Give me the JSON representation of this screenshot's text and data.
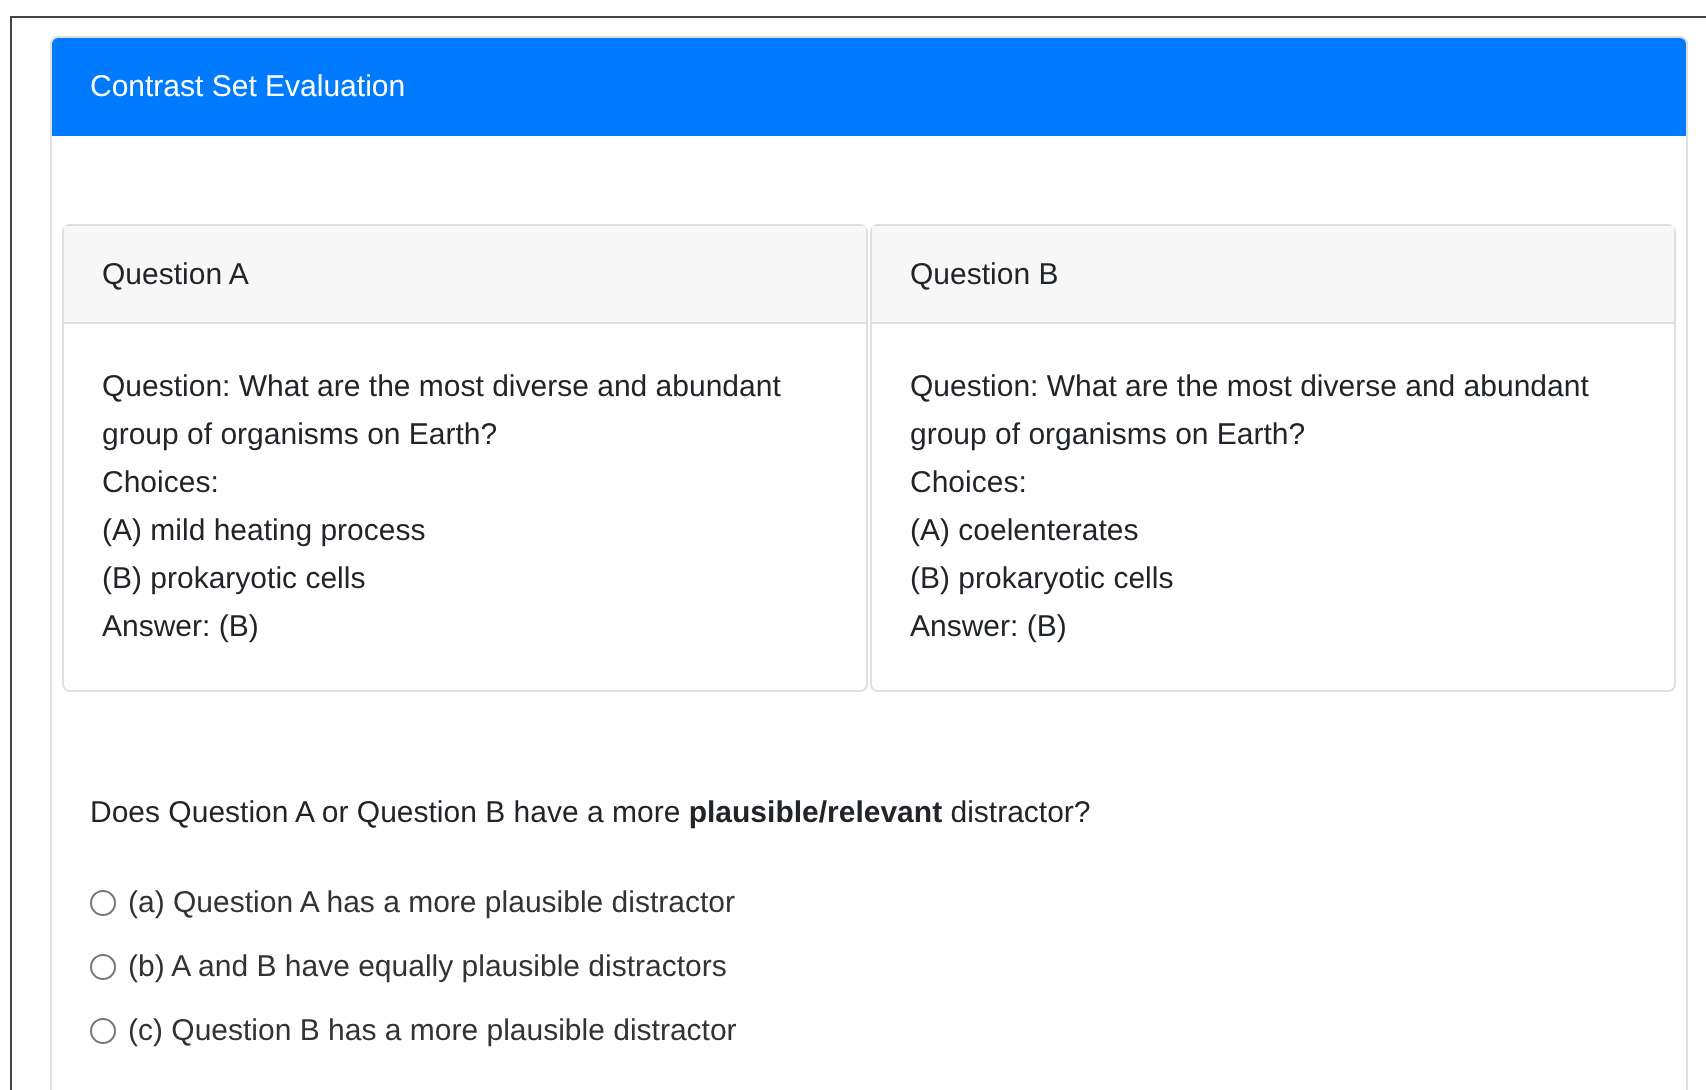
{
  "card": {
    "title": "Contrast Set Evaluation"
  },
  "panels": [
    {
      "title": "Question A",
      "lines": [
        "Question: What are the most diverse and abundant group of organisms on Earth?",
        "Choices:",
        "(A) mild heating process",
        "(B) prokaryotic cells",
        "Answer: (B)"
      ]
    },
    {
      "title": "Question B",
      "lines": [
        "Question: What are the most diverse and abundant group of organisms on Earth?",
        "Choices:",
        "(A) coelenterates",
        "(B) prokaryotic cells",
        "Answer: (B)"
      ]
    }
  ],
  "prompt": "Does Question A or Question B have a more **plausible/relevant** distractor?",
  "options": [
    {
      "label": "(a) Question A has a more plausible distractor",
      "selected": false
    },
    {
      "label": "(b) A and B have equally plausible distractors",
      "selected": false
    },
    {
      "label": "(c) Question B has a more plausible distractor",
      "selected": false
    }
  ]
}
